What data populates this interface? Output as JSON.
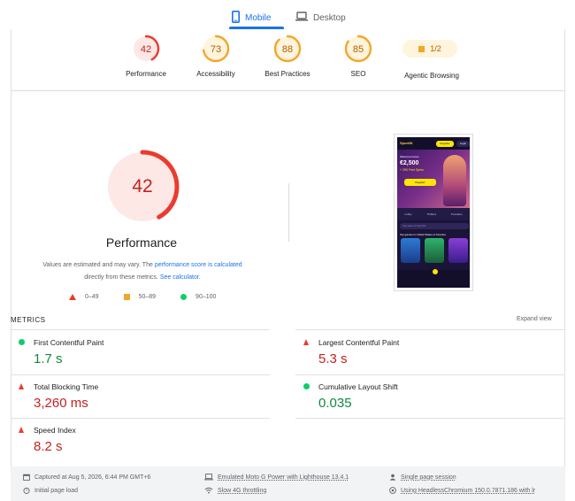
{
  "tabs": {
    "mobile": "Mobile",
    "desktop": "Desktop"
  },
  "scores": [
    {
      "label": "Performance",
      "value": "42",
      "score": 42,
      "color": "#eb3b2f",
      "bg": "#fde8e6",
      "text": "#c5221f"
    },
    {
      "label": "Accessibility",
      "value": "73",
      "score": 73,
      "color": "#f4a52b",
      "bg": "#fff4dc",
      "text": "#b06000"
    },
    {
      "label": "Best Practices",
      "value": "88",
      "score": 88,
      "color": "#f4a52b",
      "bg": "#fff4dc",
      "text": "#b06000"
    },
    {
      "label": "SEO",
      "value": "85",
      "score": 85,
      "color": "#f4a52b",
      "bg": "#fff4dc",
      "text": "#b06000"
    }
  ],
  "agentic": {
    "value": "1/2",
    "label": "Agentic Browsing"
  },
  "performance": {
    "value": "42",
    "score": 42,
    "title": "Performance",
    "note_prefix": "Values are estimated and may vary. The ",
    "note_link1": "performance score is calculated",
    "note_mid": "directly from these metrics. ",
    "note_link2": "See calculator."
  },
  "legend": {
    "poor": "0–49",
    "average": "50–89",
    "good": "90–100"
  },
  "colors": {
    "poor": "#eb3b2f",
    "average": "#f4a52b",
    "good": "#0cce6b",
    "accent": "#1a73e8"
  },
  "phone": {
    "logo": "SportIN",
    "register": "Register",
    "login": "Login",
    "promo_small": "Welcome bonus",
    "promo_amount": "€2,500",
    "promo_spins": "+ 250 Free Spins",
    "cta": "Register",
    "categories": [
      "Lobby",
      "Thrillers",
      "Providers"
    ],
    "search": "Top slots of SportIN",
    "subtitle": "Top games in United States of America"
  },
  "metrics_section": {
    "heading": "METRICS",
    "expand": "Expand view"
  },
  "metrics": [
    {
      "name": "First Contentful Paint",
      "value": "1.7 s",
      "rating": "good"
    },
    {
      "name": "Largest Contentful Paint",
      "value": "5.3 s",
      "rating": "poor"
    },
    {
      "name": "Total Blocking Time",
      "value": "3,260 ms",
      "rating": "poor"
    },
    {
      "name": "Cumulative Layout Shift",
      "value": "0.035",
      "rating": "good"
    },
    {
      "name": "Speed Index",
      "value": "8.2 s",
      "rating": "poor"
    }
  ],
  "runtime": {
    "captured": "Captured at Aug 5, 2026, 6:44 PM GMT+6",
    "load": "Initial page load",
    "device": "Emulated Moto G Power with Lighthouse 13.4.1",
    "throttle": "Slow 4G throttling",
    "session": "Single page session",
    "browser": "Using HeadlessChromium 150.0.7871.186 with lr"
  }
}
